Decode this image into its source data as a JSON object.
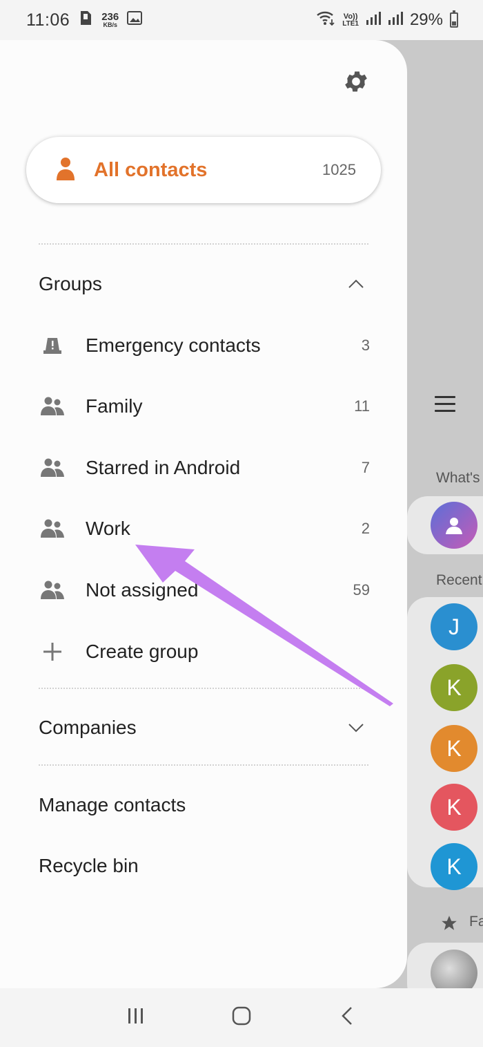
{
  "status_bar": {
    "time": "11:06",
    "net_speed": "236",
    "net_unit": "KB/s",
    "volte": "Vo))",
    "lte": "LTE1",
    "battery": "29%"
  },
  "drawer": {
    "all_contacts": {
      "label": "All contacts",
      "count": "1025",
      "accent": "#e2732b"
    },
    "groups": {
      "title": "Groups",
      "items": [
        {
          "label": "Emergency contacts",
          "count": "3",
          "icon": "emergency-icon"
        },
        {
          "label": "Family",
          "count": "11",
          "icon": "group-icon"
        },
        {
          "label": "Starred in Android",
          "count": "7",
          "icon": "group-icon"
        },
        {
          "label": "Work",
          "count": "2",
          "icon": "group-icon"
        },
        {
          "label": "Not assigned",
          "count": "59",
          "icon": "group-icon"
        }
      ],
      "create_label": "Create group"
    },
    "companies": {
      "title": "Companies"
    },
    "manage_contacts": "Manage contacts",
    "recycle_bin": "Recycle bin"
  },
  "background_list": {
    "whats_label": "What's",
    "recent_label": "Recent",
    "favorites_label": "Fa",
    "recent_avatars": [
      {
        "letter": "J",
        "color": "#2a8fd0"
      },
      {
        "letter": "K",
        "color": "#8aa32a"
      },
      {
        "letter": "K",
        "color": "#e28a2e"
      },
      {
        "letter": "K",
        "color": "#e4565f"
      },
      {
        "letter": "K",
        "color": "#1f96d4"
      }
    ]
  },
  "annotation": {
    "arrow_color": "#c47ef0"
  }
}
